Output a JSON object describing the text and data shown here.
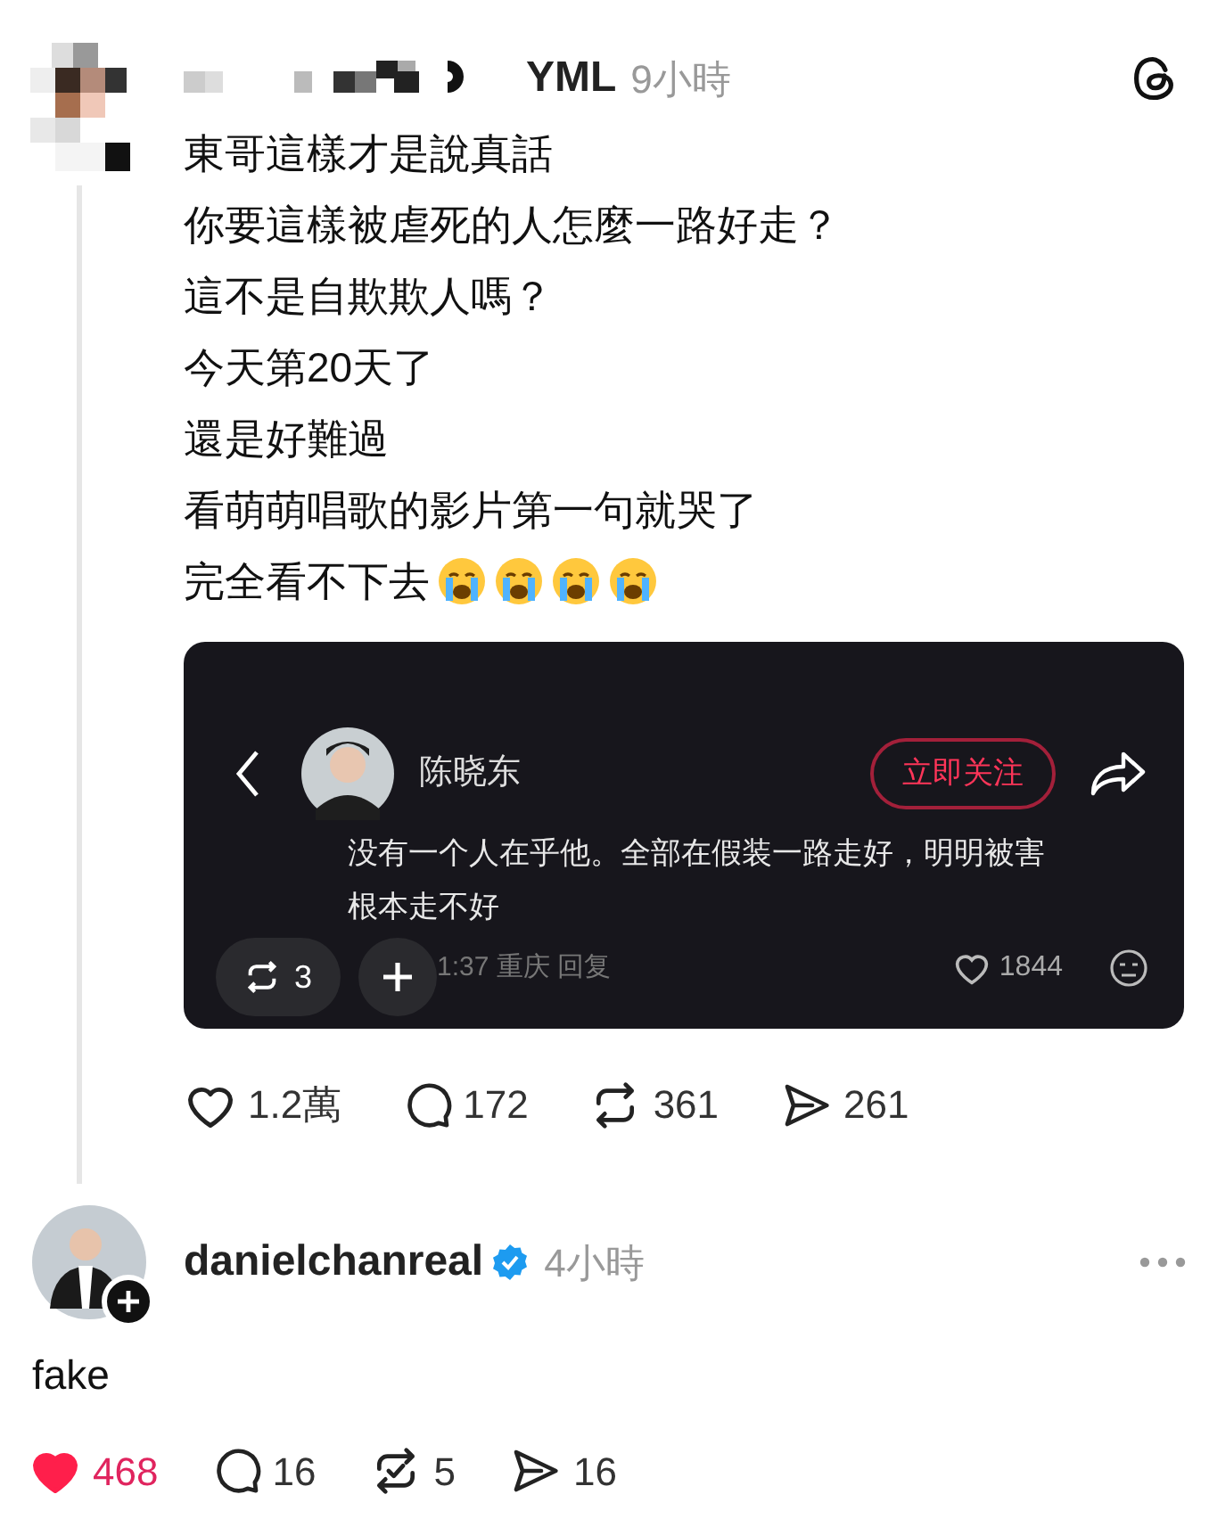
{
  "post": {
    "author": "YML",
    "time": "9小時",
    "lines": [
      "東哥這樣才是說真話",
      "你要這樣被虐死的人怎麼一路好走？",
      "這不是自欺欺人嗎？",
      "今天第20天了",
      "還是好難過",
      "看萌萌唱歌的影片第一句就哭了",
      "完全看不下去"
    ],
    "embed": {
      "name": "陈晓东",
      "follow": "立即关注",
      "text": "没有一个人在乎他。全部在假装一路走好，明明被害根本走不好",
      "meta": "1:37 重庆 回复",
      "likes": "1844",
      "repost_count": "3"
    },
    "actions": [
      {
        "kind": "like",
        "count": "1.2萬",
        "selected": false
      },
      {
        "kind": "comment",
        "count": "172"
      },
      {
        "kind": "repost",
        "count": "361",
        "selected": false
      },
      {
        "kind": "share",
        "count": "261"
      }
    ]
  },
  "reply": {
    "author": "danielchanreal",
    "verified": true,
    "time": "4小時",
    "text": "fake",
    "actions": [
      {
        "kind": "like",
        "count": "468",
        "selected": true
      },
      {
        "kind": "comment",
        "count": "16"
      },
      {
        "kind": "repost",
        "count": "5",
        "selected": true
      },
      {
        "kind": "share",
        "count": "16"
      }
    ]
  }
}
